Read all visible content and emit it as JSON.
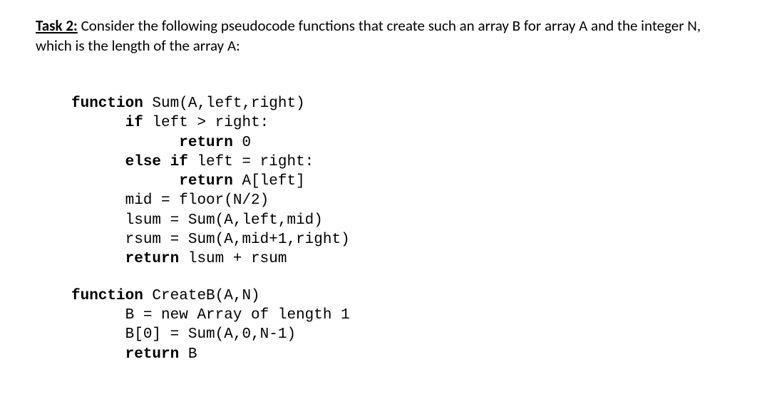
{
  "intro": {
    "task_label": "Task 2:",
    "text": " Consider the following pseudocode functions that create such an array B for array A and the integer N, which is the length of the array A:"
  },
  "code": {
    "sum": {
      "sig_kw": "function",
      "sig_name": " Sum(A,left,right)",
      "if_kw": "if",
      "if_cond": " left > right:",
      "ret1_kw": "return",
      "ret1_val": " 0",
      "elseif_kw": "else if",
      "elseif_cond": " left = right:",
      "ret2_kw": "return",
      "ret2_val": " A[left]",
      "mid_line": "mid = floor(N/2)",
      "lsum_line": "lsum = Sum(A,left,mid)",
      "rsum_line": "rsum = Sum(A,mid+1,right)",
      "ret3_kw": "return",
      "ret3_val": " lsum + rsum"
    },
    "createb": {
      "sig_kw": "function",
      "sig_name": " CreateB(A,N)",
      "b_line": "B = new Array of length 1",
      "b0_line": "B[0] = Sum(A,0,N-1)",
      "ret_kw": "return",
      "ret_val": " B"
    }
  }
}
